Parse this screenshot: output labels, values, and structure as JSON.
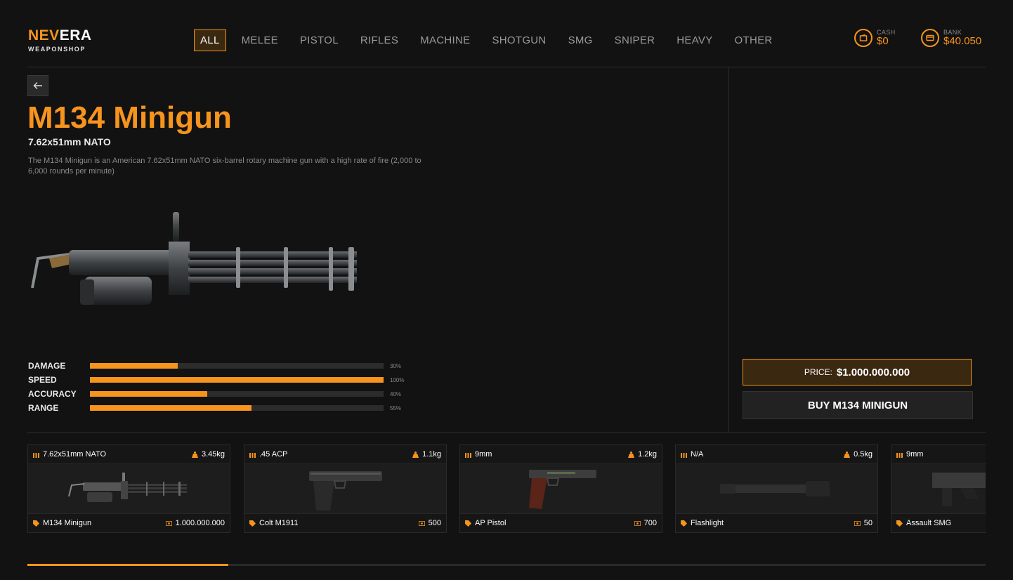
{
  "brand": {
    "name_part1": "NEV",
    "name_part2": "ERA",
    "subtitle": "WEAPONSHOP"
  },
  "nav": {
    "items": [
      "ALL",
      "MELEE",
      "PISTOL",
      "RIFLES",
      "MACHINE",
      "SHOTGUN",
      "SMG",
      "SNIPER",
      "HEAVY",
      "OTHER"
    ],
    "active": "ALL"
  },
  "wallet": {
    "cash": {
      "label": "CASH",
      "value": "$0",
      "icon": "wallet-icon"
    },
    "bank": {
      "label": "BANK",
      "value": "$40.050",
      "icon": "card-icon"
    }
  },
  "weapon": {
    "name": "M134 Minigun",
    "caliber": "7.62x51mm NATO",
    "description": "The M134 Minigun is an American 7.62x51mm NATO six-barrel rotary machine gun with a high rate of fire (2,000 to 6,000 rounds per minute)",
    "stats": [
      {
        "label": "DAMAGE",
        "value": 30,
        "display": "30%"
      },
      {
        "label": "SPEED",
        "value": 100,
        "display": "100%"
      },
      {
        "label": "ACCURACY",
        "value": 40,
        "display": "40%"
      },
      {
        "label": "RANGE",
        "value": 55,
        "display": "55%"
      }
    ]
  },
  "purchase": {
    "price_label": "PRICE:",
    "price_value": "$1.000.000.000",
    "buy_label": "BUY M134 MINIGUN"
  },
  "cards": [
    {
      "ammo": "7.62x51mm NATO",
      "weight": "3.45kg",
      "name": "M134 Minigun",
      "price": "1.000.000.000",
      "image": "minigun"
    },
    {
      "ammo": ".45 ACP",
      "weight": "1.1kg",
      "name": "Colt M1911",
      "price": "500",
      "image": "pistol"
    },
    {
      "ammo": "9mm",
      "weight": "1.2kg",
      "name": "AP Pistol",
      "price": "700",
      "image": "appistol"
    },
    {
      "ammo": "N/A",
      "weight": "0.5kg",
      "name": "Flashlight",
      "price": "50",
      "image": "flashlight"
    },
    {
      "ammo": "9mm",
      "weight": "",
      "name": "Assault SMG",
      "price": "",
      "image": "smg"
    }
  ],
  "colors": {
    "accent": "#f7941d",
    "background": "#121212",
    "panel": "#1a1a1a"
  },
  "scrollbar": {
    "visible_fraction": 0.21
  }
}
